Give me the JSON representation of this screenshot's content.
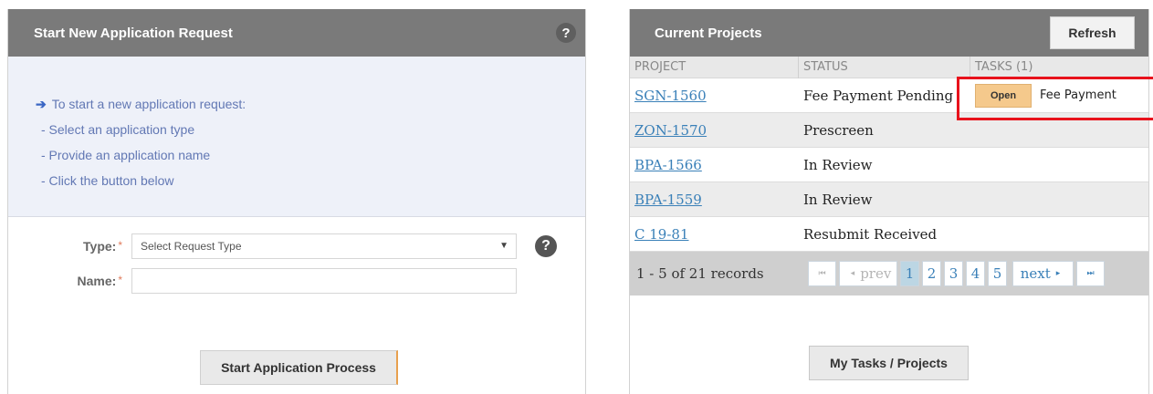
{
  "left": {
    "title": "Start New Application Request",
    "help_glyph": "?",
    "info": {
      "arrow_glyph": "➔",
      "intro": "To start a new application request:",
      "steps": [
        "- Select an application type",
        "- Provide an application name",
        "- Click the button below"
      ]
    },
    "form": {
      "type_label": "Type:",
      "name_label": "Name:",
      "required_mark": "*",
      "type_selected": "Select Request Type",
      "name_value": "",
      "caret_glyph": "▼"
    },
    "start_button": "Start Application Process"
  },
  "right": {
    "title": "Current Projects",
    "refresh_button": "Refresh",
    "columns": [
      "PROJECT",
      "STATUS",
      "TASKS (1)"
    ],
    "rows": [
      {
        "project": "SGN-1560",
        "status": "Fee Payment Pending",
        "task_badge": "Open",
        "task_name": "Fee Payment"
      },
      {
        "project": "ZON-1570",
        "status": "Prescreen",
        "task_badge": "",
        "task_name": ""
      },
      {
        "project": "BPA-1566",
        "status": "In Review",
        "task_badge": "",
        "task_name": ""
      },
      {
        "project": "BPA-1559",
        "status": "In Review",
        "task_badge": "",
        "task_name": ""
      },
      {
        "project": "C 19-81",
        "status": "Resubmit Received",
        "task_badge": "",
        "task_name": ""
      }
    ],
    "pager": {
      "records": "1 - 5 of 21 records",
      "first_glyph": "⏮",
      "prev_label": "prev",
      "prev_glyph": "◂",
      "pages": [
        "1",
        "2",
        "3",
        "4",
        "5"
      ],
      "current_page": "1",
      "next_label": "next",
      "next_glyph": "▸",
      "last_glyph": "⏭"
    },
    "tasks_button": "My Tasks / Projects"
  },
  "colors": {
    "header_bg": "#7a7a7a",
    "info_bg": "#eef1f9",
    "link": "#3a80b8",
    "badge": "#f5c98c",
    "highlight": "#e8121c"
  }
}
